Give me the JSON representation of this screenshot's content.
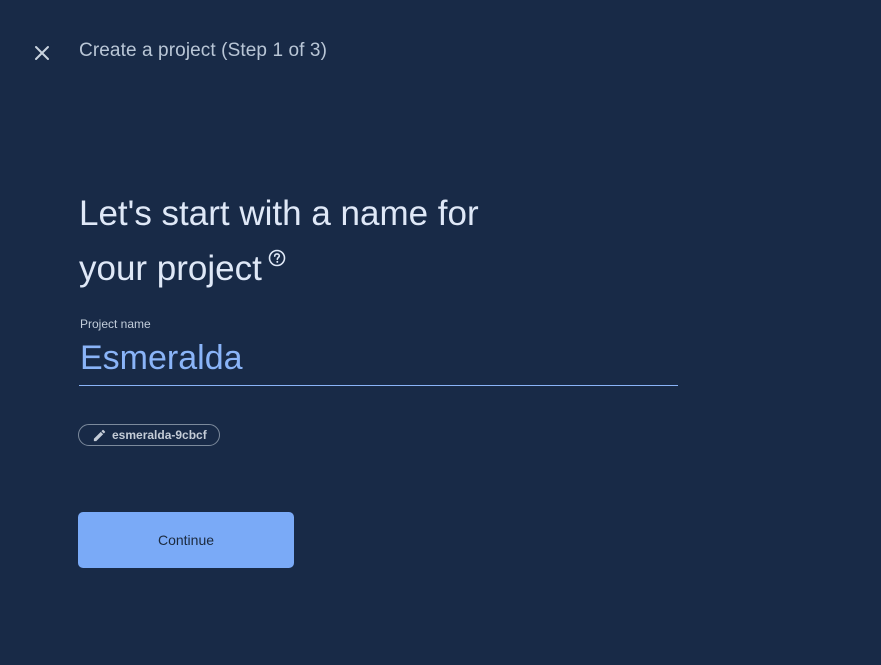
{
  "header": {
    "title": "Create a project (Step 1 of 3)",
    "close_icon": "close-icon"
  },
  "main": {
    "heading_line1": "Let's start with a name for",
    "heading_line2": "your project",
    "help_icon": "help-circle-icon",
    "project_name_label": "Project name",
    "project_name_value": "Esmeralda",
    "project_id": "esmeralda-9cbcf",
    "project_id_icon": "pencil-icon",
    "continue_label": "Continue"
  },
  "colors": {
    "background": "#182a47",
    "accent": "#8ab4f8",
    "button_bg": "#7aaaf7",
    "heading_text": "#dfe8f7"
  }
}
